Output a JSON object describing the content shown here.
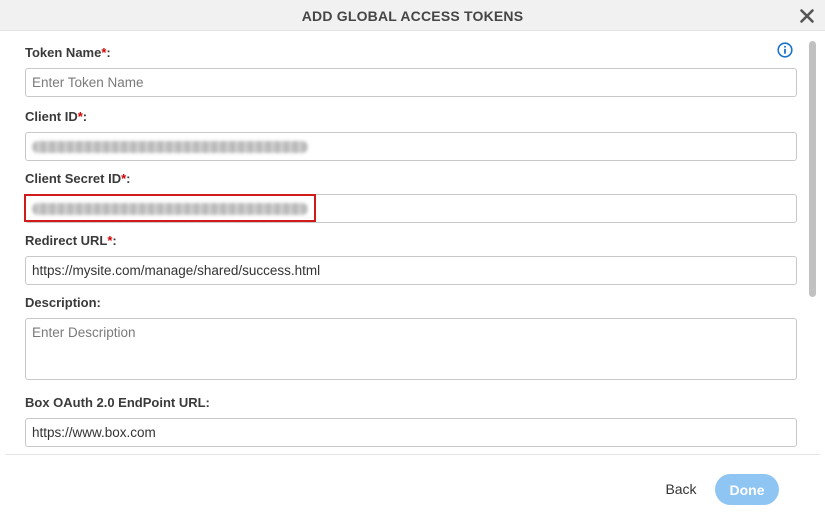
{
  "dialog": {
    "title": "ADD GLOBAL ACCESS TOKENS",
    "required_mark": "*",
    "fields": {
      "token_name": {
        "label": "Token Name",
        "suffix": ":",
        "value": "",
        "placeholder": "Enter Token Name"
      },
      "client_id": {
        "label": "Client ID",
        "suffix": ":",
        "value_obscured": true
      },
      "client_secret_id": {
        "label": "Client Secret ID",
        "suffix": ":",
        "value_obscured": true
      },
      "redirect_url": {
        "label": "Redirect URL",
        "suffix": ":",
        "value": "https://mysite.com/manage/shared/success.html"
      },
      "description": {
        "label": "Description:",
        "value": "",
        "placeholder": "Enter Description"
      },
      "box_oauth_endpoint": {
        "label": "Box OAuth 2.0 EndPoint URL:",
        "value": "https://www.box.com"
      }
    },
    "footer": {
      "back_label": "Back",
      "done_label": "Done"
    }
  },
  "colors": {
    "required": "#d40000",
    "highlight": "#d11a1a",
    "done_button": "#8ec5f3",
    "info_icon": "#1a73c8"
  },
  "icons": {
    "close": "close-icon",
    "info": "info-icon"
  }
}
